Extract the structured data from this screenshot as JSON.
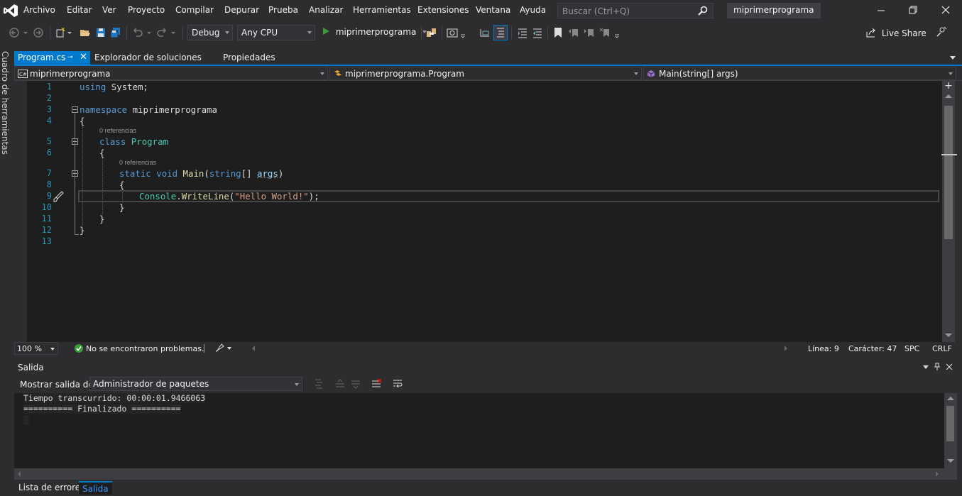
{
  "menu": {
    "items": [
      "Archivo",
      "Editar",
      "Ver",
      "Proyecto",
      "Compilar",
      "Depurar",
      "Prueba",
      "Analizar",
      "Herramientas",
      "Extensiones",
      "Ventana",
      "Ayuda"
    ]
  },
  "search": {
    "placeholder": "Buscar (Ctrl+Q)"
  },
  "solution_name": "miprimerprograma",
  "toolbar": {
    "config": "Debug",
    "platform": "Any CPU",
    "start_target": "miprimerprograma",
    "live_share": "Live Share"
  },
  "toolbox_label": "Cuadro de herramientas",
  "tabs": {
    "active": "Program.cs",
    "others": [
      "Explorador de soluciones",
      "Propiedades"
    ]
  },
  "navbar": {
    "project": "miprimerprograma",
    "class": "miprimerprograma.Program",
    "member": "Main(string[] args)"
  },
  "code": {
    "line_numbers": [
      "1",
      "2",
      "3",
      "4",
      "5",
      "6",
      "7",
      "8",
      "9",
      "10",
      "11",
      "12",
      "13"
    ],
    "l1_kw": "using",
    "l1_rest": " System;",
    "l3_kw": "namespace",
    "l3_rest": " miprimerprograma",
    "l4": "{",
    "refs_class": "0 referencias",
    "l5_kw": "class",
    "l5_type": "Program",
    "l6": "{",
    "refs_main": "0 referencias",
    "l7_kw1": "static",
    "l7_kw2": "void",
    "l7_method": "Main",
    "l7_p1": "(",
    "l7_type": "string",
    "l7_p2": "[] ",
    "l7_param": "args",
    "l7_p3": ")",
    "l8": "{",
    "l9_type": "Console",
    "l9_dot": ".",
    "l9_method": "WriteLine",
    "l9_p1": "(",
    "l9_str": "\"Hello World!\"",
    "l9_p2": ");",
    "l10": "}",
    "l11": "}",
    "l12": "}"
  },
  "editor_status": {
    "zoom": "100 %",
    "issues": "No se encontraron problemas.",
    "line": "Línea: 9",
    "char": "Carácter: 47",
    "spc": "SPC",
    "eol": "CRLF"
  },
  "output": {
    "title": "Salida",
    "show_from_label": "Mostrar salida de:",
    "source": "Administrador de paquetes",
    "lines": [
      "Tiempo transcurrido: 00:00:01.9466063",
      "========== Finalizado =========="
    ]
  },
  "bottom_tabs": [
    "Lista de errores",
    "Salida"
  ],
  "colors": {
    "accent": "#007acc",
    "bg": "#2d2d30",
    "editor_bg": "#1e1e1e",
    "ok": "#3c9b3c"
  }
}
